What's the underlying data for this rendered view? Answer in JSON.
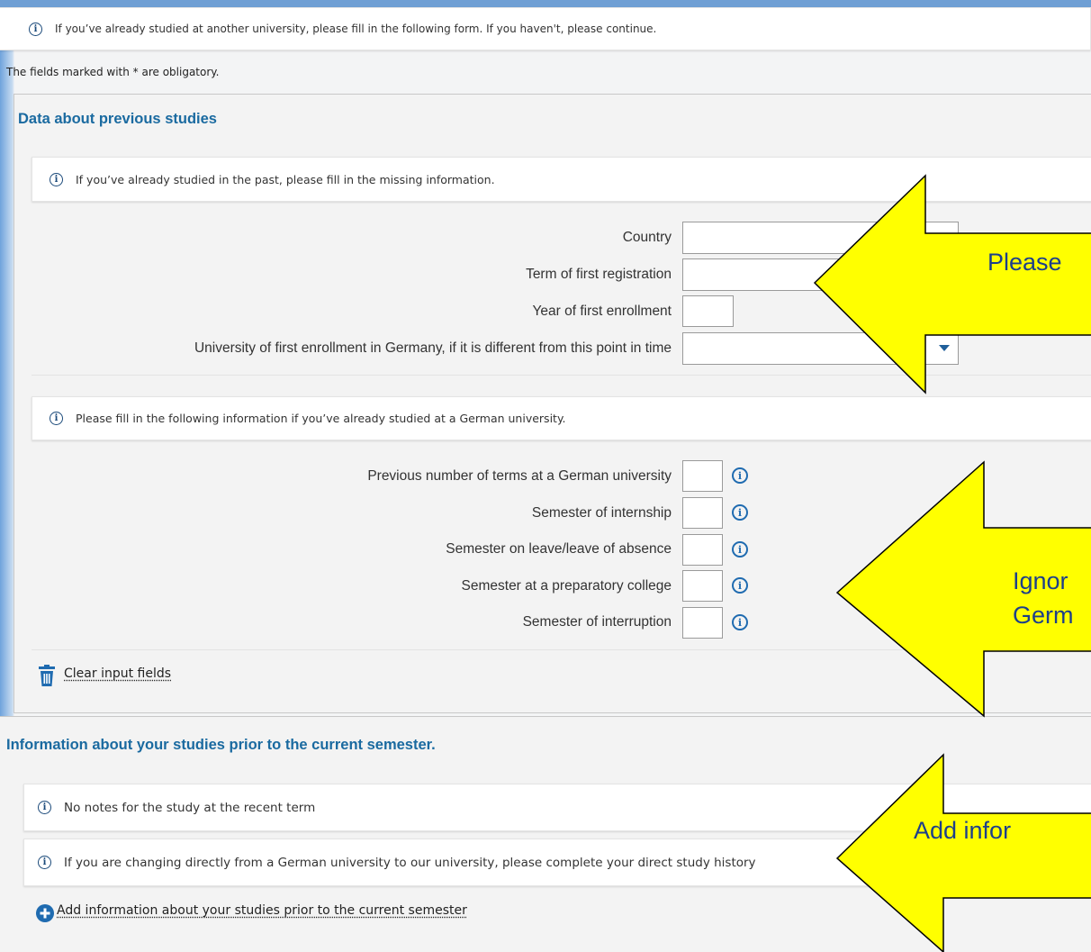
{
  "top_info": {
    "icon": "info-icon",
    "text": "If you’ve already studied at another university, please fill in the following form. If you haven't, please continue."
  },
  "obligatory_note": "The fields marked with * are obligatory.",
  "previous_studies": {
    "title": "Data about previous studies",
    "info1": "If you’ve already studied in the past, please fill in the missing information.",
    "fields": [
      {
        "label": "Country",
        "value": ""
      },
      {
        "label": "Term of first registration",
        "value": ""
      },
      {
        "label": "Year of first enrollment",
        "value": ""
      },
      {
        "label": "University of first enrollment in Germany, if it is different from this point in time",
        "value": ""
      }
    ],
    "info2": "Please fill in the following information if you’ve already studied at a German university.",
    "german_fields": [
      {
        "label": "Previous number of terms at a German university",
        "value": ""
      },
      {
        "label": "Semester of internship",
        "value": ""
      },
      {
        "label": "Semester on leave/leave of absence",
        "value": ""
      },
      {
        "label": "Semester at a preparatory college",
        "value": ""
      },
      {
        "label": "Semester of interruption",
        "value": ""
      }
    ],
    "clear_link": "Clear input fields"
  },
  "prior_studies": {
    "title": "Information about your studies prior to the current semester.",
    "info1": "No notes for the study at the recent term",
    "info2": "If you are changing directly from a German university to our university, please complete your direct study history",
    "add_link": "Add information about your studies prior to the current semester"
  },
  "callouts": [
    {
      "text": "Please"
    },
    {
      "text": "Ignor",
      "text2": "Germ"
    },
    {
      "text": "Add infor"
    }
  ],
  "colors": {
    "accent": "#1a6aa0",
    "callout_fill": "#ffff00",
    "callout_text": "#1d3f8a"
  }
}
